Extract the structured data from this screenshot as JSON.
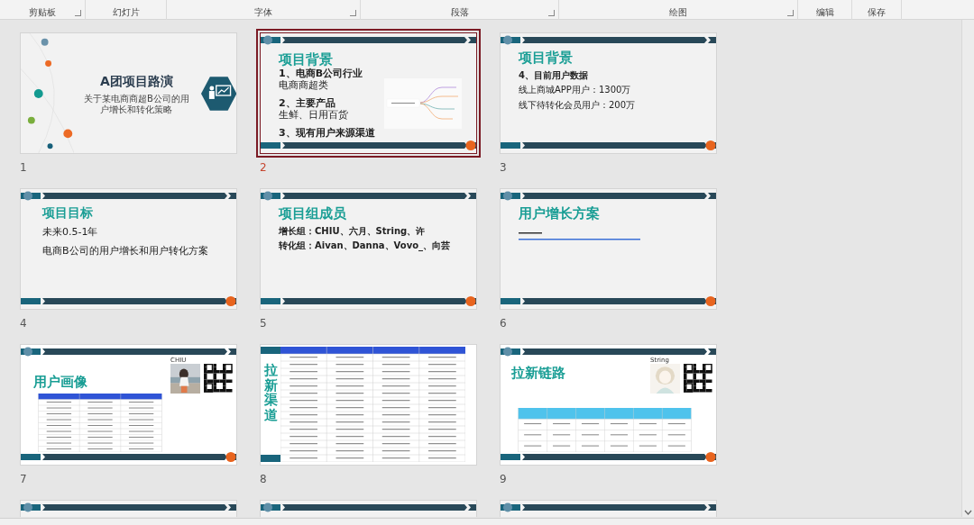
{
  "ribbon": {
    "groups": [
      {
        "label": "剪贴板",
        "launcher": true
      },
      {
        "label": "幻灯片",
        "launcher": false
      },
      {
        "label": "字体",
        "launcher": true
      },
      {
        "label": "段落",
        "launcher": true
      },
      {
        "label": "绘图",
        "launcher": true
      },
      {
        "label": "编辑",
        "launcher": false
      },
      {
        "label": "保存",
        "launcher": false
      }
    ]
  },
  "slides": [
    {
      "number": "1",
      "selected": false,
      "kind": "cover",
      "title": "A团项目路演",
      "subtitle": "关于某电商商超B公司的用户增长和转化策略"
    },
    {
      "number": "2",
      "selected": true,
      "kind": "mindmap",
      "title": "项目背景",
      "lines": [
        {
          "text": "1、电商B公司行业",
          "strong": true
        },
        {
          "text": "电商商超类",
          "strong": false
        },
        {
          "text": "2、主要产品",
          "strong": true
        },
        {
          "text": "生鲜、日用百货",
          "strong": false
        },
        {
          "text": "3、现有用户来源渠道",
          "strong": true
        }
      ]
    },
    {
      "number": "3",
      "selected": false,
      "kind": "data",
      "title": "项目背景",
      "lines": [
        {
          "text": "4、目前用户数据",
          "strong": true
        },
        {
          "text": "线上商城APP用户：1300万",
          "strong": false
        },
        {
          "text": "线下待转化会员用户：200万",
          "strong": false
        }
      ]
    },
    {
      "number": "4",
      "selected": false,
      "kind": "goal",
      "title": "项目目标",
      "lines": [
        {
          "text": "未来0.5-1年",
          "strong": false
        },
        {
          "text": "电商B公司的用户增长和用户转化方案",
          "strong": false
        }
      ]
    },
    {
      "number": "5",
      "selected": false,
      "kind": "data",
      "title": "项目组成员",
      "lines": [
        {
          "text": "增长组：CHIU、六月、String、许",
          "strong": true
        },
        {
          "text": "转化组：Aivan、Danna、Vovo_、向芸",
          "strong": true
        }
      ]
    },
    {
      "number": "6",
      "selected": false,
      "kind": "link",
      "title": "用户增长方案"
    },
    {
      "number": "7",
      "selected": false,
      "kind": "profile-photo",
      "title": "用户画像",
      "caption": "CHIU"
    },
    {
      "number": "8",
      "selected": false,
      "kind": "channels",
      "title": "拉新渠道"
    },
    {
      "number": "9",
      "selected": false,
      "kind": "profile-sketch",
      "title": "拉新链路",
      "caption": "String"
    },
    {
      "selected": false,
      "kind": "partial"
    },
    {
      "selected": false,
      "kind": "partial"
    },
    {
      "selected": false,
      "kind": "partial"
    }
  ]
}
